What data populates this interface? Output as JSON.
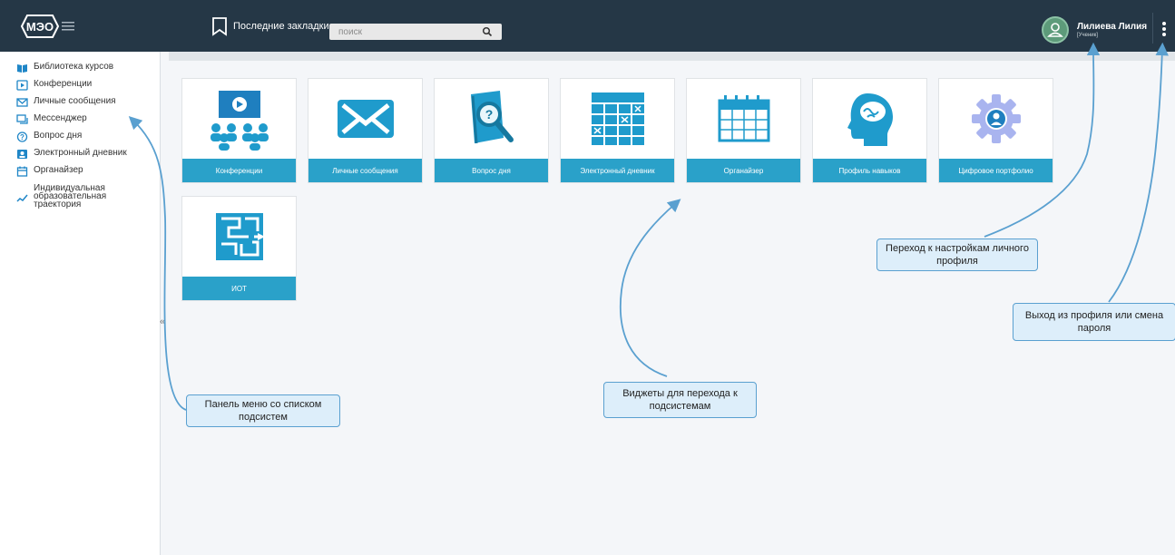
{
  "header": {
    "logo_text": "МЭО",
    "bookmarks_label": "Последние закладки",
    "search_placeholder": "поиск",
    "user_name": "Лилиева Лилия",
    "user_role": "[Ученик]"
  },
  "sidebar": {
    "items": [
      {
        "label": "Библиотека курсов",
        "icon": "book-icon"
      },
      {
        "label": "Конференции",
        "icon": "play-icon"
      },
      {
        "label": "Личные сообщения",
        "icon": "mail-icon"
      },
      {
        "label": "Мессенджер",
        "icon": "chat-icon"
      },
      {
        "label": "Вопрос дня",
        "icon": "question-icon"
      },
      {
        "label": "Электронный дневник",
        "icon": "diary-icon"
      },
      {
        "label": "Органайзер",
        "icon": "calendar-icon"
      },
      {
        "label": "Индивидуальная образовательная траектория",
        "icon": "trend-icon"
      }
    ],
    "collapse_glyph": "«"
  },
  "widgets": [
    {
      "label": "Конференции",
      "icon": "conference-icon"
    },
    {
      "label": "Личные сообщения",
      "icon": "envelope-icon"
    },
    {
      "label": "Вопрос дня",
      "icon": "question-magnifier-icon"
    },
    {
      "label": "Электронный дневник",
      "icon": "diary-grid-icon"
    },
    {
      "label": "Органайзер",
      "icon": "organizer-calendar-icon"
    },
    {
      "label": "Профиль навыков",
      "icon": "brain-head-icon"
    },
    {
      "label": "Цифровое портфолио",
      "icon": "portfolio-gear-icon"
    },
    {
      "label": "ИОТ",
      "icon": "maze-icon"
    }
  ],
  "callouts": {
    "menu_panel": "Панель меню со списком подсистем",
    "widgets": "Виджеты для перехода к подсистемам",
    "profile_settings": "Переход к настройкам личного профиля",
    "logout": "Выход из профиля или смена пароля"
  },
  "colors": {
    "topbar": "#253746",
    "widget_label": "#2aa1c9",
    "callout_bg": "#ddeefa",
    "callout_border": "#5aa0d0"
  }
}
